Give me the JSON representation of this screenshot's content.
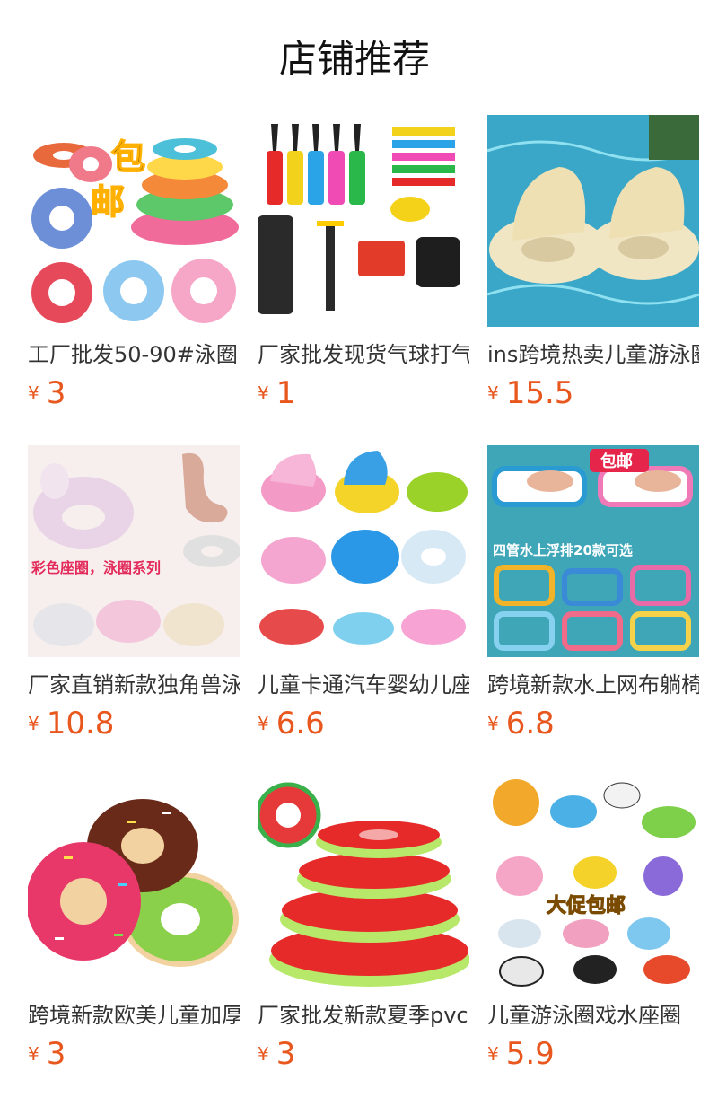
{
  "page": {
    "title": "店铺推荐"
  },
  "products": [
    {
      "name": "工厂批发50-90#泳圈",
      "currency": "¥",
      "price": "3",
      "badge": "包邮",
      "icon": "swim-ring-stack-icon"
    },
    {
      "name": "厂家批发现货气球打气筒",
      "currency": "¥",
      "price": "1",
      "icon": "air-pump-icon"
    },
    {
      "name": "ins跨境热卖儿童游泳圈",
      "currency": "¥",
      "price": "15.5",
      "icon": "baby-float-pool-icon"
    },
    {
      "name": "厂家直销新款独角兽泳圈",
      "currency": "¥",
      "price": "10.8",
      "badge": "彩色座圈，泳圈系列",
      "icon": "unicorn-float-icon"
    },
    {
      "name": "儿童卡通汽车婴幼儿座圈",
      "currency": "¥",
      "price": "6.6",
      "icon": "kids-seat-float-icon"
    },
    {
      "name": "跨境新款水上网布躺椅",
      "currency": "¥",
      "price": "6.8",
      "badge": "包邮",
      "badge2": "四管水上浮排20款可选",
      "icon": "water-hammock-icon"
    },
    {
      "name": "跨境新款欧美儿童加厚泳圈",
      "currency": "¥",
      "price": "3",
      "icon": "donut-ring-icon"
    },
    {
      "name": "厂家批发新款夏季pvc西瓜泳圈",
      "currency": "¥",
      "price": "3",
      "icon": "watermelon-ring-icon"
    },
    {
      "name": "儿童游泳圈戏水座圈",
      "currency": "¥",
      "price": "5.9",
      "badge": "大促包邮",
      "icon": "animal-floats-icon"
    }
  ]
}
